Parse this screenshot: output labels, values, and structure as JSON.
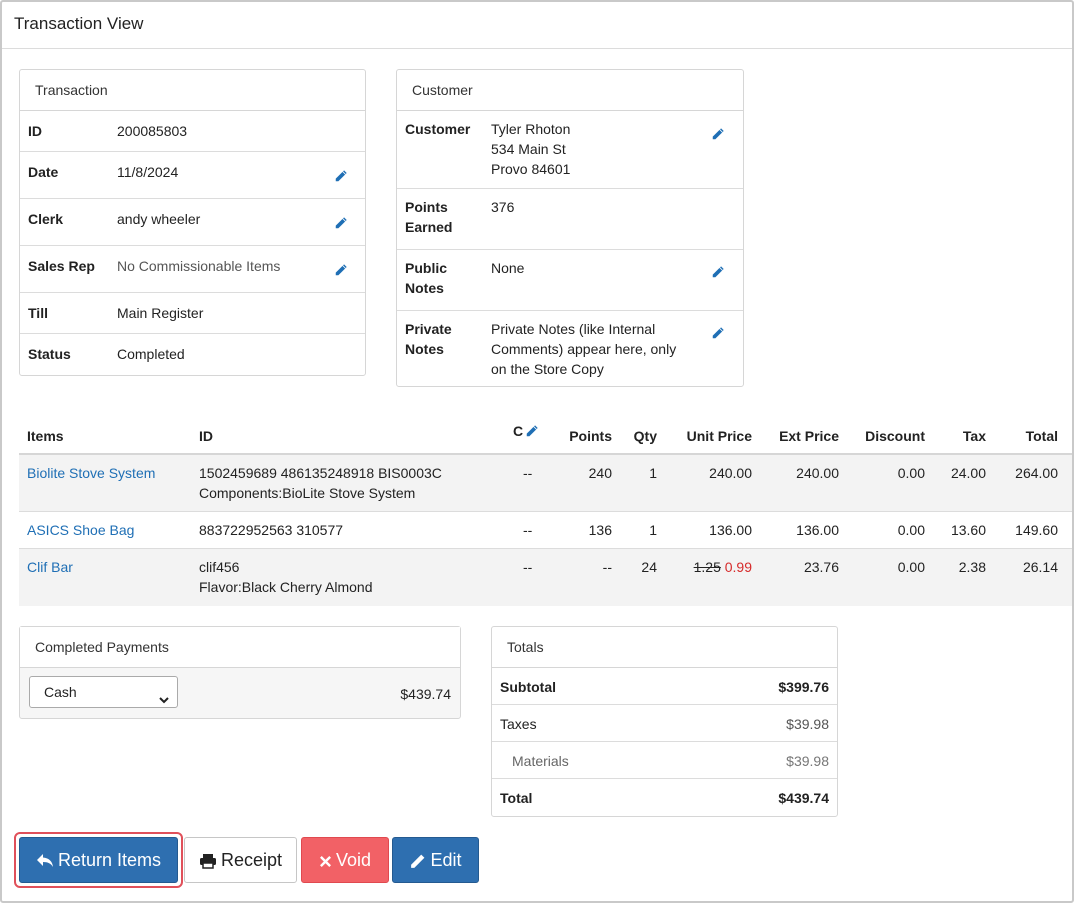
{
  "page": {
    "title": "Transaction View"
  },
  "transaction": {
    "heading": "Transaction",
    "rows": [
      {
        "key": "ID",
        "value": "200085803",
        "editable": false
      },
      {
        "key": "Date",
        "value": "11/8/2024",
        "editable": true
      },
      {
        "key": "Clerk",
        "value": "andy wheeler",
        "editable": true
      },
      {
        "key": "Sales Rep",
        "value": "No Commissionable Items",
        "editable": true
      },
      {
        "key": "Till",
        "value": "Main Register",
        "editable": false
      },
      {
        "key": "Status",
        "value": "Completed",
        "editable": false
      }
    ]
  },
  "customer": {
    "heading": "Customer",
    "rows": [
      {
        "key_line1": "Customer",
        "key_line2": "",
        "lines": [
          "Tyler Rhoton",
          "534 Main St",
          "Provo 84601"
        ],
        "editable": true
      },
      {
        "key_line1": "Points",
        "key_line2": "Earned",
        "lines": [
          "376"
        ],
        "editable": false
      },
      {
        "key_line1": "Public",
        "key_line2": "Notes",
        "lines": [
          "None"
        ],
        "editable": true
      },
      {
        "key_line1": "Private",
        "key_line2": "Notes",
        "lines": [
          "Private Notes (like Internal",
          "Comments) appear here, only",
          "on the Store Copy"
        ],
        "editable": true
      }
    ]
  },
  "items": {
    "headers": {
      "items": "Items",
      "id": "ID",
      "c": "C",
      "points": "Points",
      "qty": "Qty",
      "unit_price": "Unit Price",
      "ext_price": "Ext Price",
      "discount": "Discount",
      "tax": "Tax",
      "total": "Total"
    },
    "rows": [
      {
        "name": "Biolite Stove System",
        "id_line1": "1502459689 486135248918 BIS0003C",
        "id_line2": "Components:BioLite Stove System",
        "c": "--",
        "points": "240",
        "qty": "1",
        "orig_price": "",
        "unit_price": "240.00",
        "ext_price": "240.00",
        "discount": "0.00",
        "tax": "24.00",
        "total": "264.00"
      },
      {
        "name": "ASICS Shoe Bag",
        "id_line1": "883722952563 310577",
        "id_line2": "",
        "c": "--",
        "points": "136",
        "qty": "1",
        "orig_price": "",
        "unit_price": "136.00",
        "ext_price": "136.00",
        "discount": "0.00",
        "tax": "13.60",
        "total": "149.60"
      },
      {
        "name": "Clif Bar",
        "id_line1": "clif456",
        "id_line2": "Flavor:Black Cherry Almond",
        "c": "--",
        "points": "--",
        "qty": "24",
        "orig_price": "1.25",
        "unit_price": "0.99",
        "ext_price": "23.76",
        "discount": "0.00",
        "tax": "2.38",
        "total": "26.14"
      }
    ]
  },
  "payments": {
    "heading": "Completed Payments",
    "method": "Cash",
    "amount": "$439.74"
  },
  "totals": {
    "heading": "Totals",
    "rows": [
      {
        "label": "Subtotal",
        "value": "$399.76",
        "bold": true
      },
      {
        "label": "Taxes",
        "value": "$39.98",
        "bold": false
      },
      {
        "label": "Materials",
        "value": "$39.98",
        "bold": false
      },
      {
        "label": "Total",
        "value": "$439.74",
        "bold": true
      }
    ]
  },
  "actions": {
    "return_label": "Return Items",
    "receipt_label": "Receipt",
    "void_label": "Void",
    "edit_label": "Edit"
  },
  "colors": {
    "link": "#1f6fb5",
    "primary": "#2e6fb0",
    "danger": "#f26166",
    "sale_price": "#d62b2b",
    "highlight": "#e0505a"
  }
}
